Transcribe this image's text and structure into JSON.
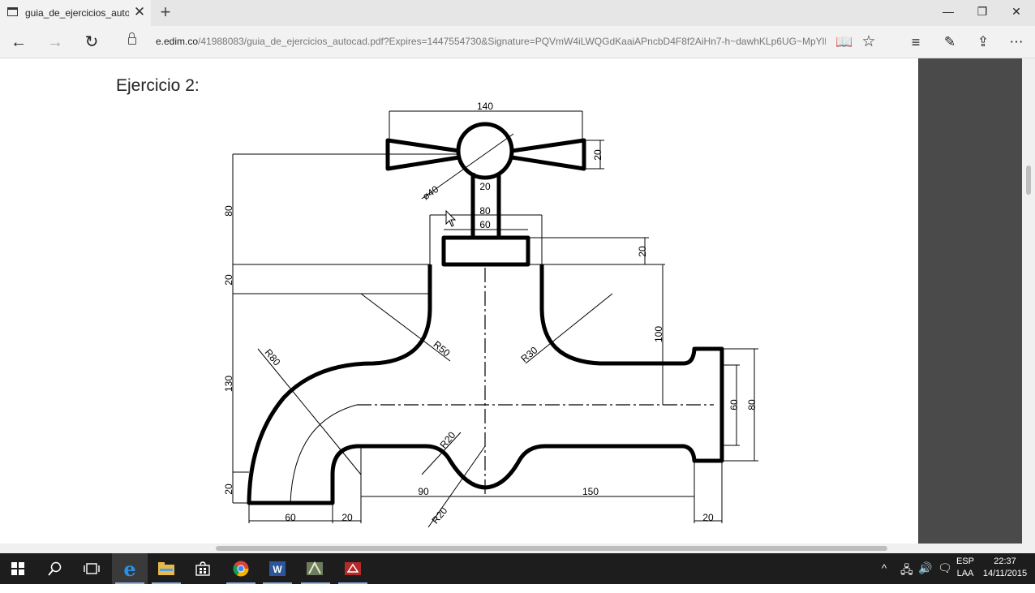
{
  "tab": {
    "title": "guia_de_ejercicios_autoc"
  },
  "address": {
    "domain": "e.edim.co",
    "path": "/41988083/guia_de_ejercicios_autocad.pdf?Expires=1447554730&Signature=PQVmW4iLWQGdKaaiAPncbD4F8f2AiHn7-h~dawhKLp6UG~MpYlR"
  },
  "document": {
    "heading": "Ejercicio 2:",
    "dimensions": {
      "d140": "140",
      "d20a": "20",
      "dia40": "ø40",
      "d20b": "20",
      "d80a": "80",
      "d60a": "60",
      "d20c": "20",
      "d80b": "80",
      "d20d": "20",
      "d100": "100",
      "r50": "R50",
      "r30a": "R30",
      "r80": "R80",
      "d130": "130",
      "d60b": "60",
      "d80c": "80",
      "r20a": "R20",
      "d20e": "20",
      "d90": "90",
      "d150": "150",
      "d60c": "60",
      "d20f": "20",
      "r20b": "R20",
      "d20g": "20"
    }
  },
  "taskbar": {
    "language": "ESP",
    "layout": "LAA",
    "time": "22:37",
    "date": "14/11/2015"
  },
  "colors": {
    "accent": "#0078d7",
    "taskbar": "#1d1d1d",
    "pdf_side": "#4a4a4a"
  }
}
